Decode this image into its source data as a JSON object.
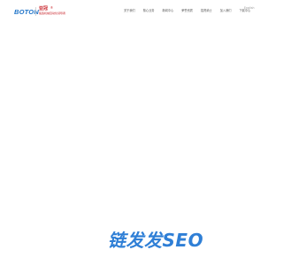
{
  "header": {
    "logo_text": "BOTON",
    "brand_name_cn": "亚冠",
    "brand_badge": "®",
    "brand_tagline": "锻造机械自动化领导者",
    "language_selector": "English"
  },
  "nav": {
    "items": [
      {
        "label": "关于我们"
      },
      {
        "label": "核心业务"
      },
      {
        "label": "新闻中心"
      },
      {
        "label": "荣誉资质"
      },
      {
        "label": "招贤纳士"
      },
      {
        "label": "加入我们"
      },
      {
        "label": "下载中心"
      }
    ]
  },
  "watermark": {
    "text": "链发发SEO"
  },
  "colors": {
    "logo_blue": "#1e73c8",
    "brand_red": "#c9252c",
    "watermark_blue": "#2f7fd6",
    "nav_text": "#555555"
  }
}
